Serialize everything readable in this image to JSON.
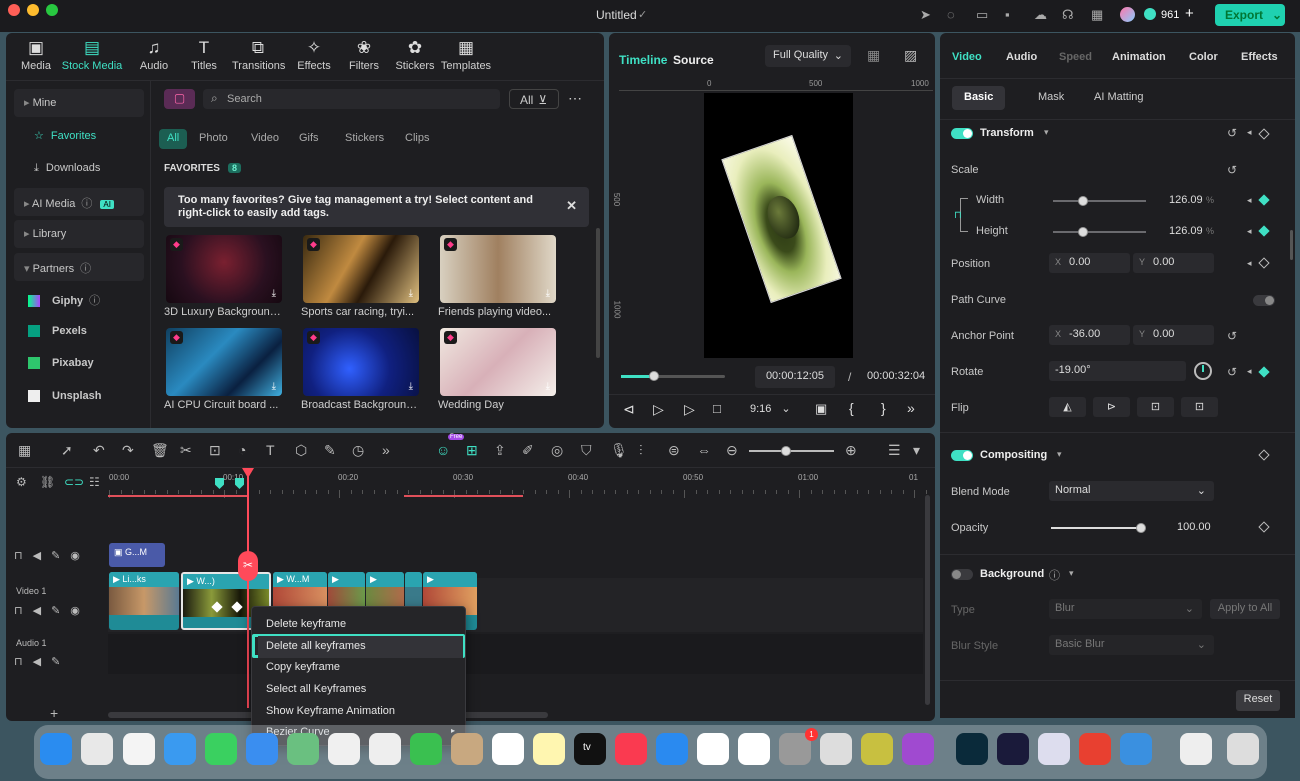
{
  "window": {
    "title": "Untitled",
    "credits": "961",
    "export_label": "Export"
  },
  "toolbar": [
    {
      "label": "Media",
      "icon": "media-icon",
      "glyph": "▣"
    },
    {
      "label": "Stock Media",
      "icon": "stock-media-icon",
      "glyph": "▤"
    },
    {
      "label": "Audio",
      "icon": "audio-icon",
      "glyph": "♫"
    },
    {
      "label": "Titles",
      "icon": "titles-icon",
      "glyph": "T"
    },
    {
      "label": "Transitions",
      "icon": "transitions-icon",
      "glyph": "⧉"
    },
    {
      "label": "Effects",
      "icon": "effects-icon",
      "glyph": "✧"
    },
    {
      "label": "Filters",
      "icon": "filters-icon",
      "glyph": "❀"
    },
    {
      "label": "Stickers",
      "icon": "stickers-icon",
      "glyph": "✿"
    },
    {
      "label": "Templates",
      "icon": "templates-icon",
      "glyph": "▦"
    }
  ],
  "sidebar": {
    "mine": "Mine",
    "favorites": "Favorites",
    "downloads": "Downloads",
    "ai_media": "AI Media",
    "ai_badge": "AI",
    "library": "Library",
    "partners": "Partners",
    "giphy": "Giphy",
    "pexels": "Pexels",
    "pixabay": "Pixabay",
    "unsplash": "Unsplash"
  },
  "browser": {
    "search_placeholder": "Search",
    "all_button": "All",
    "filters": [
      "All",
      "Photo",
      "Video",
      "Gifs",
      "Stickers",
      "Clips"
    ],
    "section": "FAVORITES",
    "count": "8",
    "tip": "Too many favorites? Give tag management a try! Select content and right-click to easily add tags.",
    "items": [
      {
        "caption": "3D Luxury Background..."
      },
      {
        "caption": "Sports car racing, tryi..."
      },
      {
        "caption": "Friends playing video..."
      },
      {
        "caption": "AI CPU Circuit board ..."
      },
      {
        "caption": "Broadcast Background..."
      },
      {
        "caption": "Wedding Day"
      }
    ]
  },
  "player": {
    "tab_timeline": "Timeline",
    "tab_source": "Source",
    "quality": "Full Quality",
    "ruler": [
      "0",
      "500",
      "1000"
    ],
    "vruler": [
      "500",
      "1000"
    ],
    "current": "00:00:12:05",
    "sep": "/",
    "total": "00:00:32:04",
    "aspect": "9:16",
    "progress": 0.32
  },
  "props": {
    "tabs": [
      "Video",
      "Audio",
      "Speed",
      "Animation",
      "Color",
      "Effects"
    ],
    "subtabs": [
      "Basic",
      "Mask",
      "AI Matting"
    ],
    "transform": "Transform",
    "scale": "Scale",
    "width": "Width",
    "width_val": "126.09",
    "height": "Height",
    "height_val": "126.09",
    "pct": "%",
    "position": "Position",
    "pos_x_label": "X",
    "pos_x": "0.00",
    "pos_y_label": "Y",
    "pos_y": "0.00",
    "path_curve": "Path Curve",
    "anchor": "Anchor Point",
    "anc_x_label": "X",
    "anc_x": "-36.00",
    "anc_y_label": "Y",
    "anc_y": "0.00",
    "rotate": "Rotate",
    "rotate_val": "-19.00°",
    "flip": "Flip",
    "compositing": "Compositing",
    "blend_mode": "Blend Mode",
    "blend_val": "Normal",
    "opacity": "Opacity",
    "opacity_val": "100.00",
    "background": "Background",
    "type": "Type",
    "type_val": "Blur",
    "apply_all": "Apply to All",
    "blur_style": "Blur Style",
    "blur_style_val": "Basic Blur",
    "reset": "Reset"
  },
  "timeline": {
    "ruler": [
      "00:00",
      "00:10",
      "00:20",
      "00:30",
      "00:40",
      "00:50",
      "01:00",
      "01"
    ],
    "video_track": "Video 1",
    "audio_track": "Audio 1",
    "free_badge": "Free",
    "clips": [
      "G...M",
      "Li...ks",
      "W...)",
      "W...M"
    ]
  },
  "context_menu": [
    "Delete keyframe",
    "Delete all keyframes",
    "Copy keyframe",
    "Select all Keyframes",
    "Show Keyframe Animation",
    "Bezier Curve"
  ],
  "dock": {
    "calendar_badge": "1",
    "apple_tv": "tv"
  },
  "colors": {
    "accent": "#3fe0c4",
    "panel": "#1e1e21",
    "bg": "#141416"
  }
}
